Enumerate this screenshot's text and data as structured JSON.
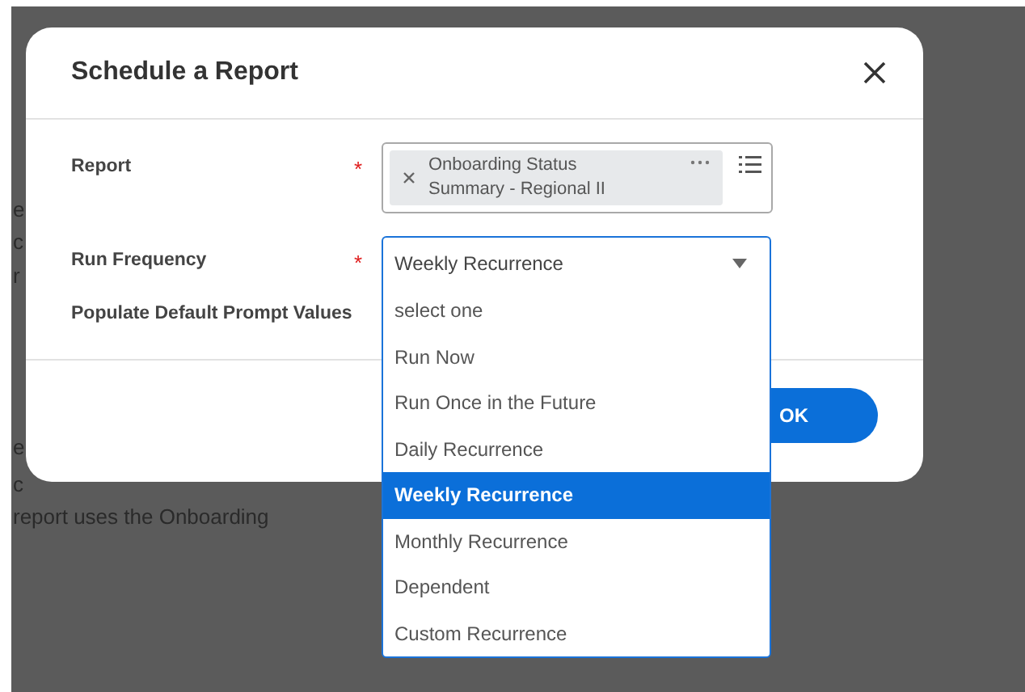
{
  "background": {
    "text_fragments": [
      "e",
      "c",
      "r",
      "e",
      "c",
      "report uses the Onboarding"
    ]
  },
  "dialog": {
    "title": "Schedule a Report",
    "fields": [
      {
        "kind": "multiselect",
        "label": "Report",
        "required_mark": "*",
        "chips": [
          {
            "text": "Onboarding Status Summary - Regional II"
          }
        ]
      },
      {
        "kind": "select",
        "label": "Run Frequency",
        "required_mark": "*",
        "value": "Weekly Recurrence",
        "expanded": true,
        "options": [
          {
            "label": "select one",
            "selected": false
          },
          {
            "label": "Run Now",
            "selected": false
          },
          {
            "label": "Run Once in the Future",
            "selected": false
          },
          {
            "label": "Daily Recurrence",
            "selected": false
          },
          {
            "label": "Weekly Recurrence",
            "selected": true
          },
          {
            "label": "Monthly Recurrence",
            "selected": false
          },
          {
            "label": "Dependent",
            "selected": false
          },
          {
            "label": "Custom Recurrence",
            "selected": false
          }
        ]
      },
      {
        "kind": "plain",
        "label": "Populate Default Prompt Values"
      }
    ],
    "buttons": [
      {
        "label": "OK",
        "kind": "primary"
      }
    ]
  }
}
